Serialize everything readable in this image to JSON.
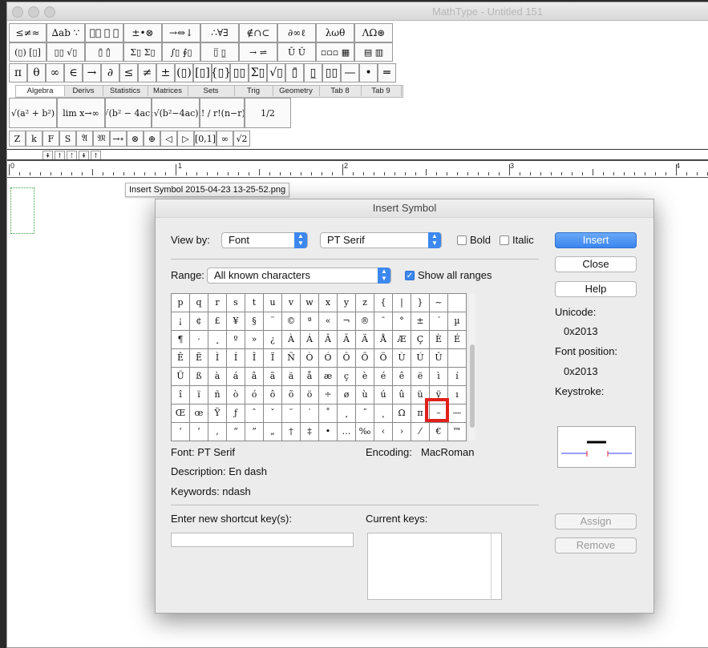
{
  "window": {
    "title": "MathType - Untitled 151"
  },
  "toolbar": {
    "row1": [
      "≤≠≈",
      "∆ab ∵",
      "⸌⃑ ⃗ ⃛",
      "±•⊗",
      "→⇔↓",
      "∴∀∃",
      "∉∩⊂",
      "∂∞ℓ",
      "λωθ",
      "ΛΩ⊛"
    ],
    "row2": [
      "(▯) [▯]",
      "▯▯ √▯",
      "▯̄ ▯̂",
      "Σ▯ Σ▯",
      "∫▯ ∮▯",
      "▯̅ ▯̲",
      "→ ⇌",
      "Ū Ŭ",
      "▫▫▫ ▦",
      "▤ ▥"
    ],
    "row3": [
      "π",
      "θ",
      "∞",
      "∈",
      "→",
      "∂",
      "≤",
      "≠",
      "±",
      "(▯)",
      "[▯]",
      "{▯}",
      "▯▯",
      "Σ▯",
      "√▯",
      "▯̄",
      "▯̲",
      "▯▯",
      "—",
      "•",
      "═"
    ],
    "tabs": [
      "Algebra",
      "Derivs",
      "Statistics",
      "Matrices",
      "Sets",
      "Trig",
      "Geometry",
      "Tab 8",
      "Tab 9"
    ],
    "templates": [
      "√(a² + b²)",
      "lim x→∞",
      "√(b² − 4ac)",
      "−b±√(b²−4ac) / 2a",
      "n! / r!(n−r)!",
      "1/2"
    ],
    "small_row": [
      "Z",
      "k",
      "F",
      "S",
      "𝔄",
      "𝔐",
      "→∘",
      "⊗",
      "⊕",
      "◁",
      "▷",
      "[0,1]",
      "∞",
      "√2"
    ],
    "mini_row": [
      "⇞",
      "↑",
      "⇡",
      "⇞",
      "↑"
    ]
  },
  "ruler": {
    "labels": [
      "0",
      "1",
      "2",
      "3",
      "4"
    ]
  },
  "tooltip": "Insert Symbol 2015-04-23 13-25-52.png",
  "dialog": {
    "title": "Insert Symbol",
    "view_by_label": "View by:",
    "view_by_value": "Font",
    "font_value": "PT Serif",
    "bold_label": "Bold",
    "italic_label": "Italic",
    "range_label": "Range:",
    "range_value": "All known characters",
    "show_all_label": "Show all ranges",
    "buttons": {
      "insert": "Insert",
      "close": "Close",
      "help": "Help",
      "assign": "Assign",
      "remove": "Remove"
    },
    "unicode_label": "Unicode:",
    "unicode_value": "0x2013",
    "font_position_label": "Font position:",
    "font_position_value": "0x2013",
    "keystroke_label": "Keystroke:",
    "font_info": "Font: PT Serif",
    "encoding_label": "Encoding:",
    "encoding_value": "MacRoman",
    "description": "Description:  En dash",
    "keywords": "Keywords: ndash",
    "shortcut_label": "Enter new shortcut key(s):",
    "current_keys_label": "Current keys:",
    "symbols": [
      [
        "p",
        "q",
        "r",
        "s",
        "t",
        "u",
        "v",
        "w",
        "x",
        "y",
        "z",
        "{",
        "|",
        "}",
        "~",
        ""
      ],
      [
        "¡",
        "¢",
        "£",
        "¥",
        "§",
        "¨",
        "©",
        "ª",
        "«",
        "¬",
        "®",
        "¯",
        "°",
        "±",
        "´",
        "µ"
      ],
      [
        "¶",
        "·",
        "¸",
        "º",
        "»",
        "¿",
        "À",
        "Á",
        "Â",
        "Ã",
        "Ä",
        "Å",
        "Æ",
        "Ç",
        "È",
        "É"
      ],
      [
        "Ê",
        "Ë",
        "Ì",
        "Í",
        "Î",
        "Ï",
        "Ñ",
        "Ò",
        "Ó",
        "Ô",
        "Õ",
        "Ö",
        "Ù",
        "Ú",
        "Û",
        ""
      ],
      [
        "Ü",
        "ß",
        "à",
        "á",
        "â",
        "ã",
        "ä",
        "å",
        "æ",
        "ç",
        "è",
        "é",
        "ê",
        "ë",
        "ì",
        "í"
      ],
      [
        "î",
        "ï",
        "ñ",
        "ò",
        "ó",
        "ô",
        "õ",
        "ö",
        "÷",
        "ø",
        "ù",
        "ú",
        "û",
        "ü",
        "ÿ",
        "ı"
      ],
      [
        "Œ",
        "œ",
        "Ÿ",
        "ƒ",
        "ˆ",
        "ˇ",
        "˘",
        "˙",
        "˚",
        "¸",
        "˝",
        "˛",
        "Ω",
        "π",
        "–",
        "—"
      ],
      [
        "‘",
        "’",
        "‚",
        "“",
        "”",
        "„",
        "†",
        "‡",
        "•",
        "…",
        "‰",
        "‹",
        "›",
        "⁄",
        "€",
        "™"
      ]
    ]
  }
}
